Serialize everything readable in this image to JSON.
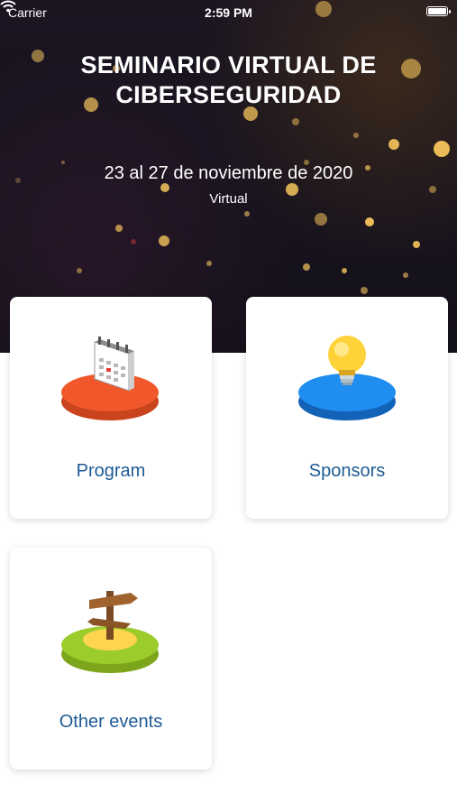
{
  "status_bar": {
    "carrier": "Carrier",
    "time": "2:59 PM"
  },
  "header": {
    "title": "SEMINARIO VIRTUAL DE CIBERSEGURIDAD",
    "dates": "23 al 27 de noviembre de 2020",
    "mode": "Virtual"
  },
  "menu": [
    {
      "label": "Program",
      "icon": "calendar-icon",
      "color": "#f0572a"
    },
    {
      "label": "Sponsors",
      "icon": "lightbulb-icon",
      "color": "#1f8ef0"
    },
    {
      "label": "Other events",
      "icon": "signpost-icon",
      "color": "#9ccc2b"
    }
  ]
}
